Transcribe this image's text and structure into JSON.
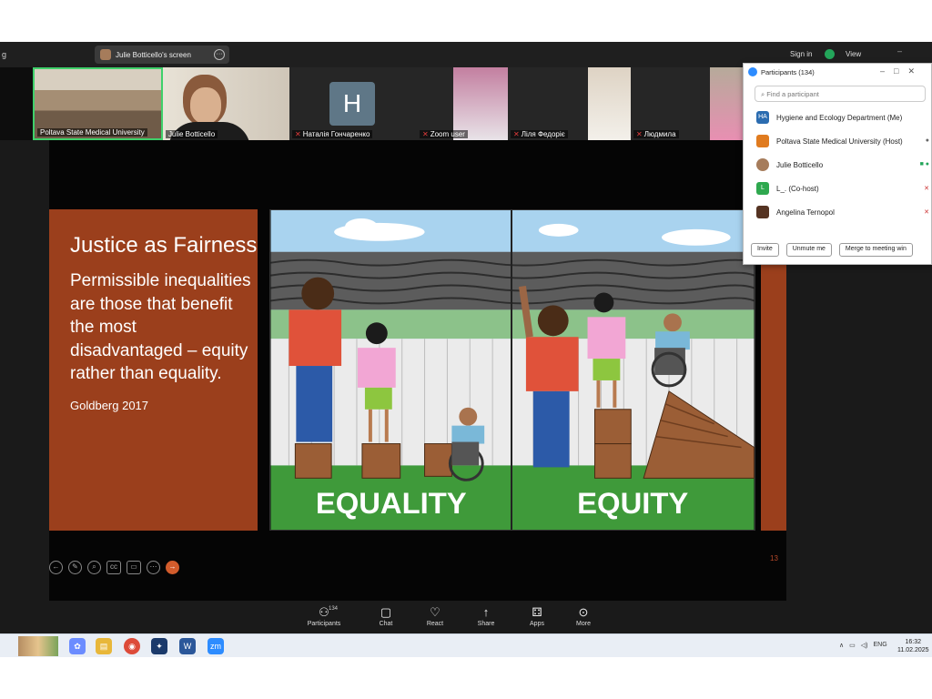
{
  "topbar": {
    "share_label": "Julie Botticello's screen",
    "sign_in": "Sign in",
    "view": "View"
  },
  "participants_strip": [
    {
      "name": "Poltava State Medical University"
    },
    {
      "name": "Julie Botticello"
    },
    {
      "name": "Наталія Гончаренко",
      "initial": "H"
    },
    {
      "name": "Zoom user"
    },
    {
      "name": "Ліля Федоріє"
    },
    {
      "name": "Людмила"
    }
  ],
  "slide": {
    "title": "Justice as Fairness",
    "body": "Permissible inequalities are those that benefit the most disadvantaged – equity rather than equality.",
    "citation": "Goldberg 2017",
    "image_label_left": "EQUALITY",
    "image_label_right": "EQUITY",
    "page_number": "13"
  },
  "participants_panel": {
    "title": "Participants (134)",
    "search_placeholder": "Find a participant",
    "rows": [
      {
        "name": "Hygiene and Ecology Department (Me)",
        "avatar": "HA",
        "color": "#2b6cb0"
      },
      {
        "name": "Poltava State Medical University (Host)",
        "avatar": "",
        "color": "#e07b1f"
      },
      {
        "name": "Julie Botticello",
        "avatar": "",
        "color": "#a67c5b"
      },
      {
        "name": "L_. (Co-host)",
        "avatar": "L",
        "color": "#2fa84f"
      },
      {
        "name": "Angelina Ternopol",
        "avatar": "",
        "color": "#553322"
      }
    ],
    "invite": "Invite",
    "unmute": "Unmute me",
    "merge": "Merge to meeting win"
  },
  "toolbar": {
    "participants": "Participants",
    "participants_count": "134",
    "chat": "Chat",
    "react": "React",
    "share": "Share",
    "apps": "Apps",
    "more": "More"
  },
  "taskbar": {
    "lang": "ENG",
    "time": "16:32",
    "date": "11.02.2025"
  }
}
